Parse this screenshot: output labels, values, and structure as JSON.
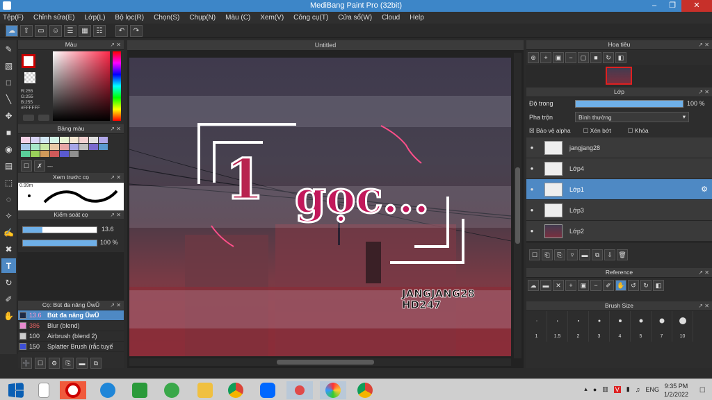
{
  "window": {
    "title": "MediBang Paint Pro (32bit)"
  },
  "menu": [
    "Tệp(F)",
    "Chỉnh sửa(E)",
    "Lớp(L)",
    "Bộ lọc(R)",
    "Chọn(S)",
    "Chụp(N)",
    "Màu (C)",
    "Xem(V)",
    "Công cụ(T)",
    "Cửa sổ(W)",
    "Cloud",
    "Help"
  ],
  "color_panel": {
    "title": "Màu",
    "r": "R:255",
    "g": "G:255",
    "b": "B:255",
    "hex": "#FFFFFF"
  },
  "palette_panel": {
    "title": "Bảng màu",
    "dashes": "---"
  },
  "brush_preview": {
    "title": "Xem trước cọ",
    "size": "0.99m"
  },
  "brush_control": {
    "title": "Kiểm soát cọ",
    "size_value": "13.6",
    "opacity_value": "100 %",
    "opacity_fraction": 1.0
  },
  "brush_list": {
    "title": "Cọ: Bút đa năng ŨwŨ",
    "items": [
      {
        "size": "13.6",
        "name": "Bút đa năng ŨwŨ",
        "color": "#1e2a44"
      },
      {
        "size": "386",
        "name": "Blur (blend)",
        "color": "#e88ad0"
      },
      {
        "size": "100",
        "name": "Airbrush (blend 2)",
        "color": "#cccccc"
      },
      {
        "size": "150",
        "name": "Splatter Brush (rắc tuyế",
        "color": "#3d4fd8"
      }
    ]
  },
  "canvas": {
    "tab": "Untitled",
    "text_main_1": "1",
    "text_main_2": "gọc...",
    "signature_1": "JANGJANG28",
    "signature_2": "HD247"
  },
  "navigator": {
    "title": "Hoa tiêu"
  },
  "layers_panel": {
    "title": "Lớp",
    "opacity_label": "Độ trong",
    "opacity_value": "100 %",
    "opacity_fraction": 1.0,
    "blend_label": "Pha trộn",
    "blend_value": "Bình thường",
    "protect_alpha": "Bảo vệ alpha",
    "clipping": "Xén bớt",
    "lock": "Khóa",
    "layers": [
      {
        "name": "jangjang28",
        "selected": false
      },
      {
        "name": "Lớp4",
        "selected": false
      },
      {
        "name": "Lớp1",
        "selected": true
      },
      {
        "name": "Lớp3",
        "selected": false
      },
      {
        "name": "Lớp2",
        "selected": false
      }
    ]
  },
  "reference_panel": {
    "title": "Reference"
  },
  "brush_size_panel": {
    "title": "Brush Size",
    "sizes": [
      "1",
      "1.5",
      "2",
      "3",
      "4",
      "5",
      "7",
      "10"
    ]
  },
  "tray": {
    "language": "ENG",
    "time": "9:35 PM",
    "date": "1/2/2022"
  },
  "colors": {
    "accent": "#4e89c4",
    "titlebar": "#3d86c8",
    "pink": "#c2185b"
  }
}
